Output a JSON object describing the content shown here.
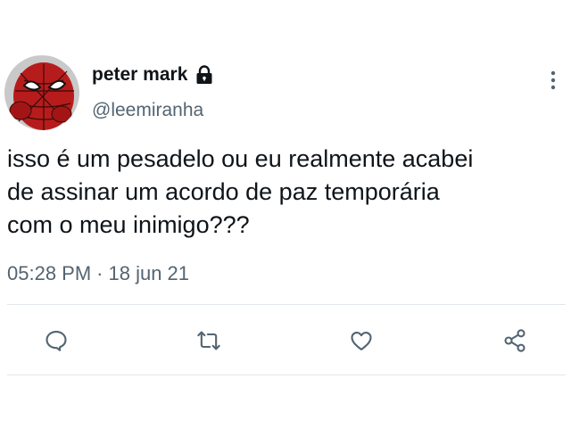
{
  "user": {
    "display_name": "peter mark",
    "handle": "@leemiranha",
    "avatar_icon": "spiderman-avatar",
    "protected_icon": "lock-icon"
  },
  "tweet": {
    "lines": [
      "isso é um pesadelo ou eu realmente acabei",
      "de assinar um acordo de paz temporária",
      "com o meu inimigo???"
    ],
    "time": "05:28 PM",
    "separator": "·",
    "date": "18 jun 21"
  },
  "actions": [
    {
      "name": "reply",
      "icon": "comment-icon"
    },
    {
      "name": "retweet",
      "icon": "retweet-icon"
    },
    {
      "name": "like",
      "icon": "heart-icon"
    },
    {
      "name": "share",
      "icon": "share-icon"
    }
  ],
  "colors": {
    "text": "#0f1419",
    "secondary": "#536471",
    "divider": "#e1e8ed",
    "icon": "#536471"
  }
}
